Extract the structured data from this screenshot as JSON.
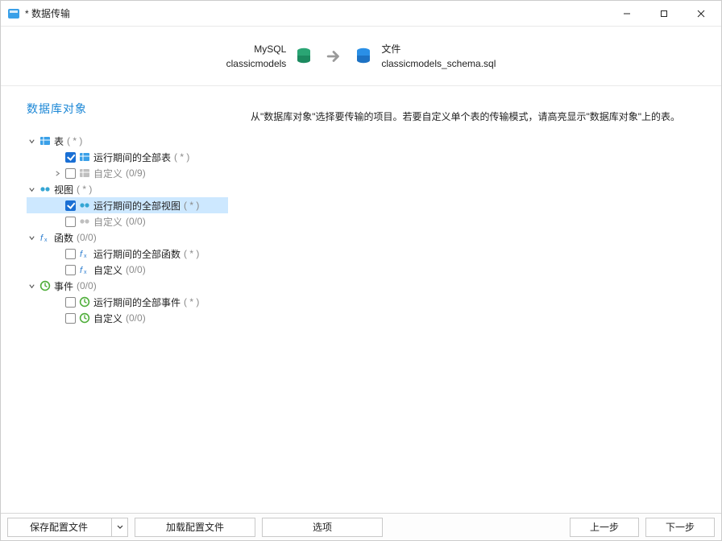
{
  "window": {
    "title": "* 数据传输"
  },
  "summary": {
    "source": {
      "line1": "MySQL",
      "line2": "classicmodels"
    },
    "target": {
      "line1": "文件",
      "line2": "classicmodels_schema.sql"
    }
  },
  "leftPanel": {
    "title": "数据库对象"
  },
  "tree": {
    "tables": {
      "label": "表",
      "count": "( * )",
      "runtimeLabel": "运行期间的全部表",
      "runtimeCount": "( * )",
      "customLabel": "自定义",
      "customCount": "(0/9)"
    },
    "views": {
      "label": "视图",
      "count": "( * )",
      "runtimeLabel": "运行期间的全部视图",
      "runtimeCount": "( * )",
      "customLabel": "自定义",
      "customCount": "(0/0)"
    },
    "funcs": {
      "label": "函数",
      "count": "(0/0)",
      "runtimeLabel": "运行期间的全部函数",
      "runtimeCount": "( * )",
      "customLabel": "自定义",
      "customCount": "(0/0)"
    },
    "events": {
      "label": "事件",
      "count": "(0/0)",
      "runtimeLabel": "运行期间的全部事件",
      "runtimeCount": "( * )",
      "customLabel": "自定义",
      "customCount": "(0/0)"
    }
  },
  "rightPanel": {
    "hint": "从\"数据库对象\"选择要传输的项目。若要自定义单个表的传输模式，请高亮显示\"数据库对象\"上的表。"
  },
  "footer": {
    "saveProfile": "保存配置文件",
    "loadProfile": "加载配置文件",
    "options": "选项",
    "prev": "上一步",
    "next": "下一步"
  }
}
